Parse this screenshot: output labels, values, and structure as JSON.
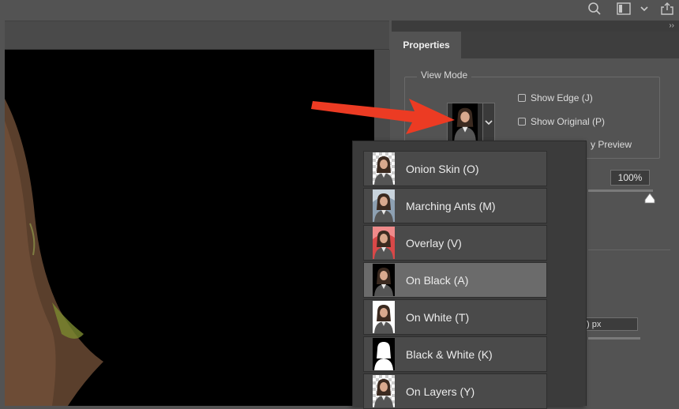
{
  "toolbar": {
    "icons": [
      "search-icon",
      "layout-icon",
      "chevron-down-icon",
      "share-icon"
    ],
    "collapse_glyph": "››"
  },
  "panel": {
    "tab_label": "Properties",
    "view_mode": {
      "legend": "View Mode",
      "show_edge": "Show Edge (J)",
      "show_original": "Show Original (P)",
      "preview_partial": "y Preview"
    },
    "opacity_value": "100%",
    "radius_value_partial": ") px"
  },
  "view_menu": {
    "selected_index": 3,
    "items": [
      {
        "label": "Onion Skin (O)",
        "thumb": "checker"
      },
      {
        "label": "Marching Ants (M)",
        "thumb": "photo"
      },
      {
        "label": "Overlay (V)",
        "thumb": "red"
      },
      {
        "label": "On Black (A)",
        "thumb": "black"
      },
      {
        "label": "On White (T)",
        "thumb": "white"
      },
      {
        "label": "Black & White (K)",
        "thumb": "mask"
      },
      {
        "label": "On Layers (Y)",
        "thumb": "checker"
      }
    ]
  },
  "colors": {
    "arrow": "#ec3b23",
    "panel_bg": "#535353",
    "menu_bg": "#3b3b3b",
    "menu_selected": "#6b6b6b"
  }
}
